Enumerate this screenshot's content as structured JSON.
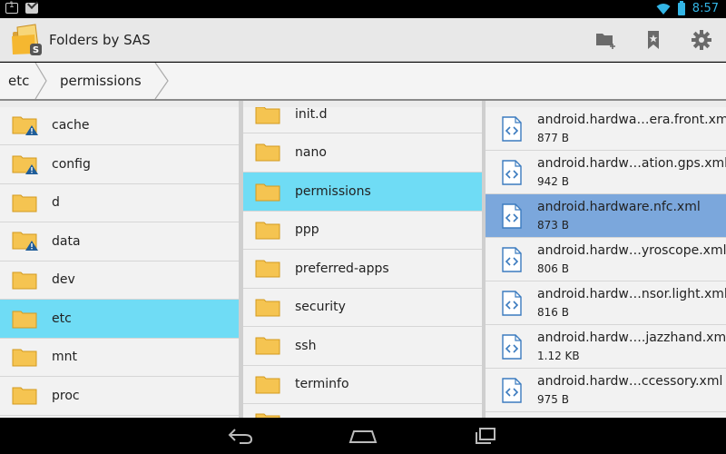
{
  "status_bar": {
    "time": "8:57",
    "icons": [
      "notification-1-icon",
      "gmail-icon",
      "wifi-icon",
      "battery-icon"
    ],
    "accent": "#33b5e5"
  },
  "action_bar": {
    "title": "Folders by SAS",
    "actions": [
      "new-folder-icon",
      "bookmark-icon",
      "settings-icon"
    ]
  },
  "breadcrumb": [
    "etc",
    "permissions"
  ],
  "colors": {
    "folder_selected": "#6fdcf5",
    "file_selected": "#7ba7dc",
    "folder": "#f5c451",
    "warning": "#1f5d99"
  },
  "pane1": {
    "items": [
      {
        "label": "cache",
        "warning": true
      },
      {
        "label": "config",
        "warning": true
      },
      {
        "label": "d",
        "warning": false
      },
      {
        "label": "data",
        "warning": true
      },
      {
        "label": "dev",
        "warning": false
      },
      {
        "label": "etc",
        "warning": false,
        "selected": true
      },
      {
        "label": "mnt",
        "warning": false
      },
      {
        "label": "proc",
        "warning": false
      }
    ]
  },
  "pane2": {
    "items": [
      {
        "label": "init.d"
      },
      {
        "label": "nano"
      },
      {
        "label": "permissions",
        "selected": true
      },
      {
        "label": "ppp"
      },
      {
        "label": "preferred-apps"
      },
      {
        "label": "security"
      },
      {
        "label": "ssh"
      },
      {
        "label": "terminfo"
      }
    ]
  },
  "pane3": {
    "items": [
      {
        "name": "android.hardwa…era.front.xml",
        "size": "877 B"
      },
      {
        "name": "android.hardw…ation.gps.xml",
        "size": "942 B"
      },
      {
        "name": "android.hardware.nfc.xml",
        "size": "873 B",
        "selected": true
      },
      {
        "name": "android.hardw…yroscope.xml",
        "size": "806 B"
      },
      {
        "name": "android.hardw…nsor.light.xml",
        "size": "816 B"
      },
      {
        "name": "android.hardw….jazzhand.xml",
        "size": "1.12 KB"
      },
      {
        "name": "android.hardw…ccessory.xml",
        "size": "975 B"
      }
    ]
  },
  "nav_bar": [
    "back-icon",
    "home-icon",
    "recents-icon"
  ]
}
